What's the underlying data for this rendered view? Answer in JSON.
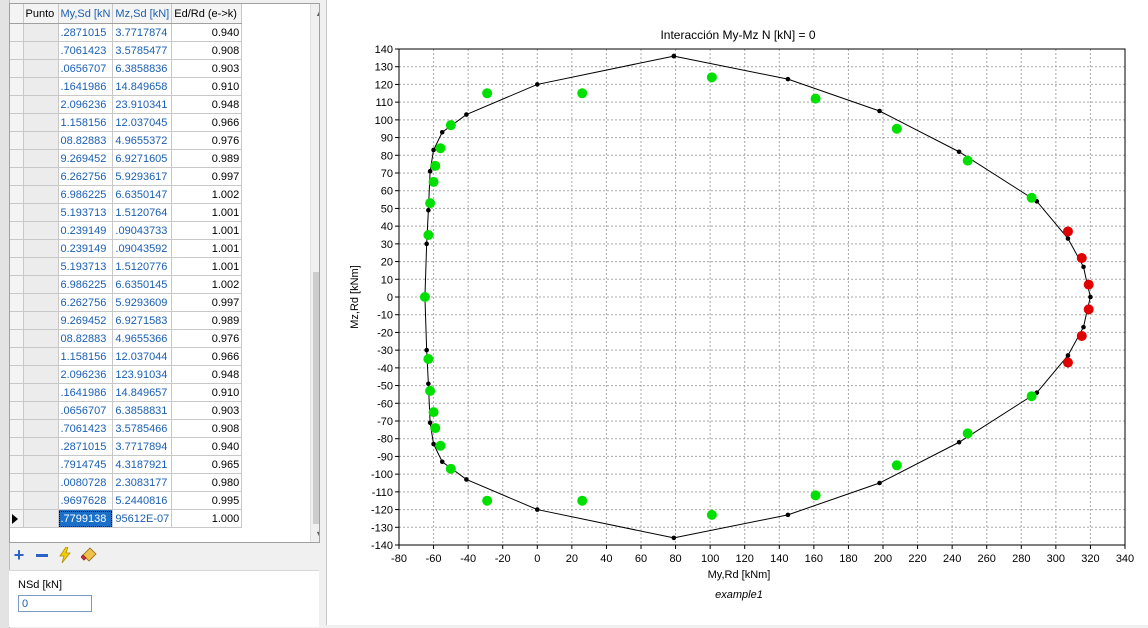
{
  "grid": {
    "columns": [
      "Punto",
      "My,Sd [kN",
      "Mz,Sd [kN]",
      "Ed/Rd (e->k)"
    ],
    "rows": [
      {
        "my": ".2871015",
        "mz": "3.7717874",
        "ed": "0.940"
      },
      {
        "my": ".7061423",
        "mz": "3.5785477",
        "ed": "0.908"
      },
      {
        "my": ".0656707",
        "mz": "6.3858836",
        "ed": "0.903"
      },
      {
        "my": ".1641986",
        "mz": "14.849658",
        "ed": "0.910"
      },
      {
        "my": "2.096236",
        "mz": "23.910341",
        "ed": "0.948"
      },
      {
        "my": "1.158156",
        "mz": "12.037045",
        "ed": "0.966"
      },
      {
        "my": "08.82883",
        "mz": "4.9655372",
        "ed": "0.976"
      },
      {
        "my": "9.269452",
        "mz": "6.9271605",
        "ed": "0.989"
      },
      {
        "my": "6.262756",
        "mz": "5.9293617",
        "ed": "0.997"
      },
      {
        "my": "6.986225",
        "mz": "6.6350147",
        "ed": "1.002"
      },
      {
        "my": "5.193713",
        "mz": "1.5120764",
        "ed": "1.001"
      },
      {
        "my": "0.239149",
        "mz": ".09043733",
        "ed": "1.001"
      },
      {
        "my": "0.239149",
        "mz": ".09043592",
        "ed": "1.001"
      },
      {
        "my": "5.193713",
        "mz": "1.5120776",
        "ed": "1.001"
      },
      {
        "my": "6.986225",
        "mz": "6.6350145",
        "ed": "1.002"
      },
      {
        "my": "6.262756",
        "mz": "5.9293609",
        "ed": "0.997"
      },
      {
        "my": "9.269452",
        "mz": "6.9271583",
        "ed": "0.989"
      },
      {
        "my": "08.82883",
        "mz": "4.9655366",
        "ed": "0.976"
      },
      {
        "my": "1.158156",
        "mz": "12.037044",
        "ed": "0.966"
      },
      {
        "my": "2.096236",
        "mz": "123.91034",
        "ed": "0.948"
      },
      {
        "my": ".1641986",
        "mz": "14.849657",
        "ed": "0.910"
      },
      {
        "my": ".0656707",
        "mz": "6.3858831",
        "ed": "0.903"
      },
      {
        "my": ".7061423",
        "mz": "3.5785466",
        "ed": "0.908"
      },
      {
        "my": ".2871015",
        "mz": "3.7717894",
        "ed": "0.940"
      },
      {
        "my": ".7914745",
        "mz": "4.3187921",
        "ed": "0.965"
      },
      {
        "my": ".0080728",
        "mz": "2.3083177",
        "ed": "0.980"
      },
      {
        "my": ".9697628",
        "mz": "5.2440816",
        "ed": "0.995"
      },
      {
        "my": ".7799138",
        "mz": "95612E-07",
        "ed": "1.000",
        "current": true
      }
    ]
  },
  "toolbar": {
    "add_icon": "plus-icon",
    "remove_icon": "minus-icon",
    "compute_icon": "lightning-icon",
    "clear_icon": "eraser-icon"
  },
  "nsd": {
    "label": "NSd [kN]",
    "value": "0"
  },
  "colors": {
    "envelope": "#000000",
    "ok_points": "#00e000",
    "fail_points": "#e00000",
    "grid": "#a8a8a8",
    "selection": "#1a6fc9"
  },
  "chart_data": {
    "type": "scatter",
    "title": "Interacción My-Mz N [kN] = 0",
    "xlabel": "My,Rd [kNm]",
    "ylabel": "Mz,Rd [kNm]",
    "footer": "example1",
    "xlim": [
      -80,
      340
    ],
    "ylim": [
      -140,
      140
    ],
    "xticks": [
      -80,
      -60,
      -40,
      -20,
      0,
      20,
      40,
      60,
      80,
      100,
      120,
      140,
      160,
      180,
      200,
      220,
      240,
      260,
      280,
      300,
      320,
      340
    ],
    "yticks": [
      -140,
      -130,
      -120,
      -110,
      -100,
      -90,
      -80,
      -70,
      -60,
      -50,
      -40,
      -30,
      -20,
      -10,
      0,
      10,
      20,
      30,
      40,
      50,
      60,
      70,
      80,
      90,
      100,
      110,
      120,
      130,
      140
    ],
    "grid": true,
    "series": [
      {
        "kind": "envelope",
        "x": [
          79,
          145,
          198,
          244,
          289,
          307,
          316,
          318,
          320,
          318,
          316,
          307,
          289,
          244,
          198,
          145,
          79,
          0,
          -41,
          -55,
          -60,
          -62,
          -63,
          -64,
          -65,
          -64,
          -63,
          -62,
          -60,
          -55,
          -41,
          0,
          79
        ],
        "y": [
          136,
          123,
          105,
          82,
          54,
          33,
          17,
          8,
          0,
          -8,
          -17,
          -33,
          -54,
          -82,
          -105,
          -123,
          -136,
          -120,
          -103,
          -93,
          -83,
          -71,
          -49,
          -30,
          0,
          30,
          49,
          71,
          83,
          93,
          103,
          120,
          136
        ]
      },
      {
        "kind": "ok",
        "x": [
          101,
          161,
          208,
          249,
          286,
          -65,
          -63,
          -62,
          -60,
          -59,
          -56,
          -50,
          -29,
          26,
          101,
          161,
          208,
          249,
          286,
          -63,
          -62,
          -60,
          -59,
          -56,
          -50,
          -29,
          26
        ],
        "y": [
          124,
          112,
          95,
          77,
          56,
          0,
          35,
          53,
          65,
          74,
          84,
          97,
          115,
          115,
          -123,
          -112,
          -95,
          -77,
          -56,
          -35,
          -53,
          -65,
          -74,
          -84,
          -97,
          -115,
          -115
        ]
      },
      {
        "kind": "fail",
        "x": [
          307,
          315,
          319,
          319,
          315,
          307
        ],
        "y": [
          37,
          22,
          7,
          -7,
          -22,
          -37
        ]
      }
    ]
  }
}
